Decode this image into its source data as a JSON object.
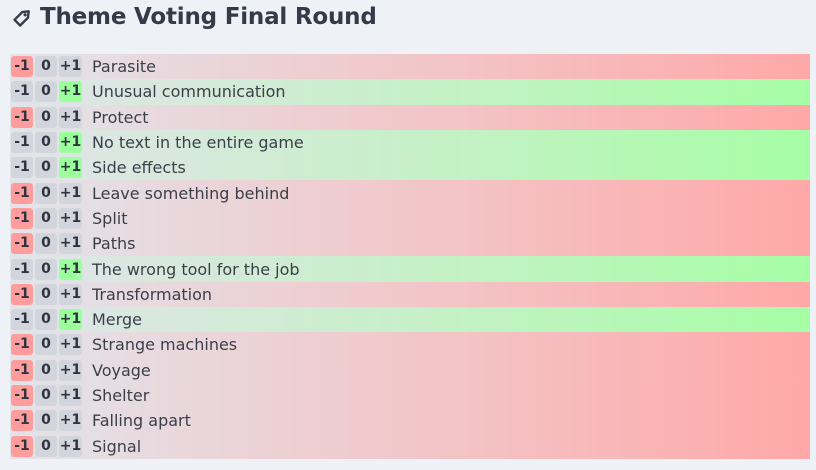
{
  "page": {
    "title": "Theme Voting Final Round",
    "title_icon": "tag-icon"
  },
  "vote_buttons": {
    "minus": "-1",
    "zero": "0",
    "plus": "+1"
  },
  "colors": {
    "negative_vote": "#ffa8a8",
    "positive_vote": "#a6fea6",
    "neutral": "#e2e4ea"
  },
  "themes": [
    {
      "label": "Parasite",
      "vote": "-1"
    },
    {
      "label": "Unusual communication",
      "vote": "+1"
    },
    {
      "label": "Protect",
      "vote": "-1"
    },
    {
      "label": "No text in the entire game",
      "vote": "+1"
    },
    {
      "label": "Side effects",
      "vote": "+1"
    },
    {
      "label": "Leave something behind",
      "vote": "-1"
    },
    {
      "label": "Split",
      "vote": "-1"
    },
    {
      "label": "Paths",
      "vote": "-1"
    },
    {
      "label": "The wrong tool for the job",
      "vote": "+1"
    },
    {
      "label": "Transformation",
      "vote": "-1"
    },
    {
      "label": "Merge",
      "vote": "+1"
    },
    {
      "label": "Strange machines",
      "vote": "-1"
    },
    {
      "label": "Voyage",
      "vote": "-1"
    },
    {
      "label": "Shelter",
      "vote": "-1"
    },
    {
      "label": "Falling apart",
      "vote": "-1"
    },
    {
      "label": "Signal",
      "vote": "-1"
    }
  ]
}
